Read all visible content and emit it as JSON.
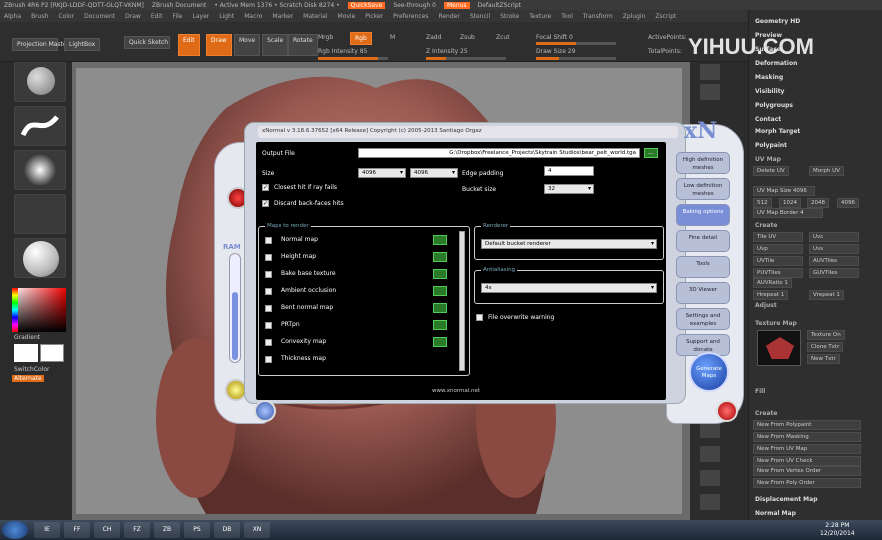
{
  "menubar": {
    "app_title": "ZBrush 4R6 P2 [RKJD-LDDF-QDTT-GLQT-VKNM]",
    "document_label": "ZBrush Document",
    "active_mem": "• Active Mem 1376 • Scratch Disk 8274 •",
    "quicksave": "QuickSave",
    "seethrough": "See-through 0",
    "menus": "Menus",
    "default_zscript": "DefaultZScript"
  },
  "menurow": {
    "items": [
      "Alpha",
      "Brush",
      "Color",
      "Document",
      "Draw",
      "Edit",
      "File",
      "Layer",
      "Light",
      "Macro",
      "Marker",
      "Material",
      "Movie",
      "Picker",
      "Preferences",
      "Render",
      "Stencil",
      "Stroke",
      "Texture",
      "Tool",
      "Transform",
      "Zplugin",
      "Zscript"
    ]
  },
  "toolbar": {
    "projection_master": "Projection Master",
    "lightbox": "LightBox",
    "quick_sketch": "Quick Sketch",
    "edit": "Edit",
    "draw": "Draw",
    "move": "Move",
    "scale": "Scale",
    "rotate": "Rotate",
    "mrgb": "Mrgb",
    "rgb": "Rgb",
    "m": "M",
    "zadd": "Zadd",
    "zsub": "Zsub",
    "zcut": "Zcut",
    "focal_shift": "Focal Shift 0",
    "draw_size": "Draw Size 29",
    "rgb_intensity": "Rgb Intensity 85",
    "z_intensity": "Z Intensity 25",
    "active_points": "ActivePoints:",
    "total_points": "TotalPoints:",
    "rgb_intensity_value": 0.85,
    "z_intensity_value": 0.25,
    "focal_shift_value": 0.5,
    "draw_size_value": 0.29
  },
  "leftshelf": {
    "gradient": "Gradient",
    "switch_color": "SwitchColor",
    "alternate": "Alternate"
  },
  "rpanel": {
    "geometry_hd": "Geometry HD",
    "preview": "Preview",
    "surface": "Surface",
    "deformation": "Deformation",
    "masking": "Masking",
    "visibility": "Visibility",
    "polygroups": "Polygroups",
    "contact": "Contact",
    "morph_target": "Morph Target",
    "polypaint": "Polypaint",
    "uv_map": "UV Map",
    "delete_uv": "Delete UV",
    "morph_uv": "Morph UV",
    "uv_map_size": "UV Map Size 4096",
    "sizes": [
      "512",
      "1024",
      "2048",
      "4096"
    ],
    "uv_map_border": "UV Map Border 4",
    "create": "Create",
    "uv_buttons": [
      "Tile UV",
      "Uvc",
      "Uvp",
      "Uvs",
      "UVTile",
      "AUVTiles",
      "PUVTiles",
      "GUVTiles"
    ],
    "auvratio": "AUVRatio 1",
    "hrepeat": "Hrepeat 1",
    "vrepeat": "Vrepeat 1",
    "adjust": "Adjust",
    "texture_map": "Texture Map",
    "texture_on": "Texture On",
    "clone_txtr": "Clone Txtr",
    "new_txtr": "New Txtr",
    "fill": "Fill",
    "create2": "Create",
    "new_from": [
      "New From Polypaint",
      "New From Masking",
      "New From UV Map",
      "New From UV Check",
      "New From Vertex Order",
      "New From Poly Order"
    ],
    "displacement_map": "Displacement Map",
    "normal_map": "Normal Map"
  },
  "watermark": {
    "part1": "YIHUU",
    "part2": ".COM"
  },
  "xnormal": {
    "title": "xNormal v 3.18.6.37652 [x64 Release] Copyright (c) 2005-2013 Santiago Orgaz",
    "logo": "xN",
    "ram_label": "RAM",
    "ram_value": 0.64,
    "output_file_label": "Output File",
    "output_file_value": "G:\\Dropbox\\Freelance_Projects\\Skytrain Studios\\bear_pelt_world.tga",
    "browse": "...",
    "size_label": "Size",
    "size_w": "4096",
    "size_h": "4096",
    "edge_padding_label": "Edge padding",
    "edge_padding_value": "4",
    "bucket_size_label": "Bucket size",
    "bucket_size_value": "32",
    "closest_hit": "Closest hit if ray fails",
    "discard_backfaces": "Discard back-faces hits",
    "maps_group": "Maps to render",
    "maps": [
      "Normal map",
      "Height map",
      "Bake base texture",
      "Ambient occlusion",
      "Bent normal map",
      "PRTpn",
      "Convexity map",
      "Thickness map"
    ],
    "renderer_group": "Renderer",
    "renderer_value": "Default bucket renderer",
    "antialias_group": "Antialiasing",
    "antialias_value": "4x",
    "overwrite_warning": "File overwrite warning",
    "footer_url": "www.xnormal.net",
    "side_buttons": [
      "High definition meshes",
      "Low definition meshes",
      "Baking options",
      "Fine detail",
      "Tools",
      "3D Viewer",
      "Settings and examples",
      "Support and donate"
    ],
    "generate": "Generate Maps"
  },
  "taskbar": {
    "apps": [
      "IE",
      "FF",
      "CH",
      "FZ",
      "ZB",
      "PS",
      "DB",
      "XN"
    ],
    "time": "2:28 PM",
    "date": "12/20/2014"
  },
  "colors": {
    "accent": "#e06b17",
    "xn_blue": "#7a8ed8",
    "panel_bg": "#2f2f2f"
  }
}
